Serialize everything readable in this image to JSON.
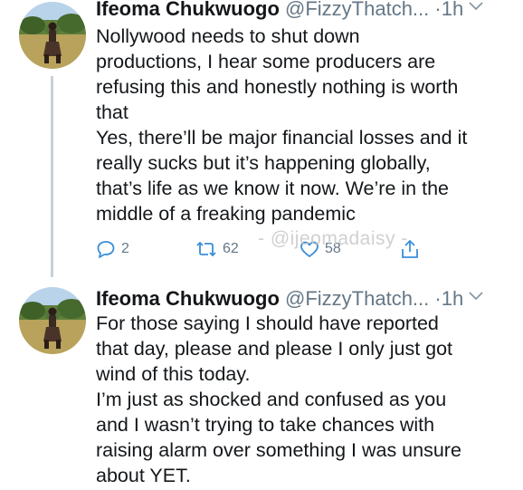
{
  "tweets": [
    {
      "author_name": "Ifeoma Chukwuogo",
      "handle": "@FizzyThatch...",
      "separator": "·",
      "time": "1h",
      "paragraphs": [
        "Nollywood needs to shut down\nproductions, I hear some producers  are\nrefusing this and honestly nothing is worth\nthat",
        "Yes, there’ll be major financial losses and it\nreally sucks but it’s happening globally,\nthat’s life as we know it now. We’re in the\nmiddle of a freaking pandemic"
      ],
      "actions": {
        "reply_count": "2",
        "retweet_count": "62",
        "like_count": "58"
      }
    },
    {
      "author_name": "Ifeoma Chukwuogo",
      "handle": "@FizzyThatch...",
      "separator": "·",
      "time": "1h",
      "paragraphs": [
        "For those saying I should have reported\nthat day, please and please I only just got\nwind of this today.",
        "I’m just as shocked and confused as you\nand I wasn’t trying to take chances with\nraising alarm over something I was unsure\nabout YET."
      ]
    }
  ],
  "watermark": "- @ijeomadaisy -",
  "colors": {
    "text": "#14171a",
    "muted": "#657786",
    "thread_line": "#c6d0d8"
  },
  "icons": [
    "reply-icon",
    "retweet-icon",
    "like-icon",
    "share-icon",
    "chevron-down-icon"
  ]
}
